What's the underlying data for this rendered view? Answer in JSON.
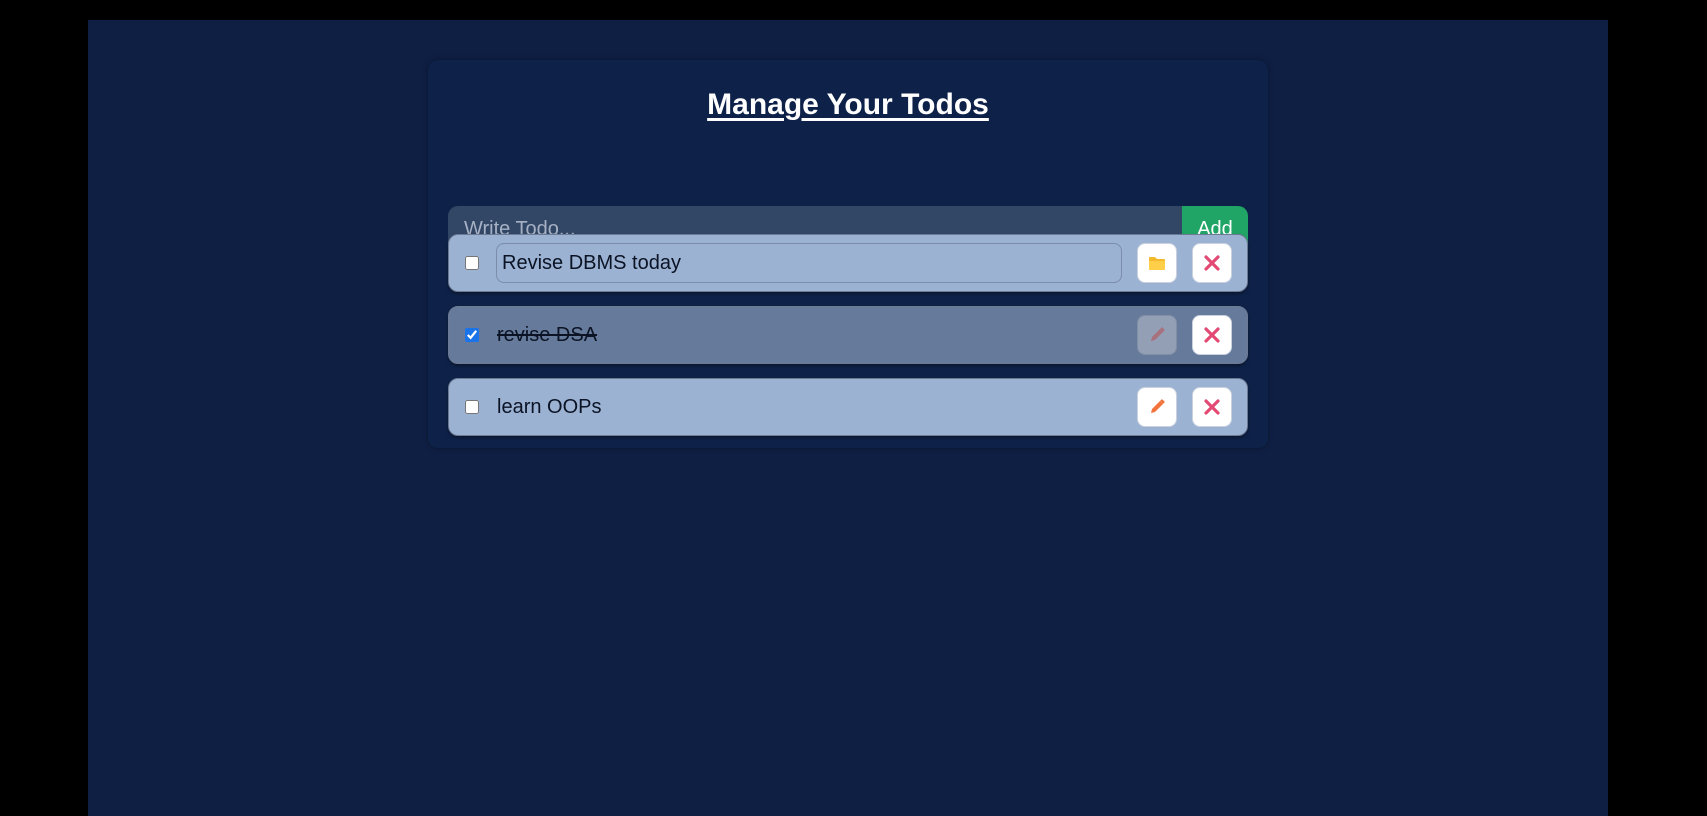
{
  "header": {
    "title": "Manage Your Todos"
  },
  "form": {
    "placeholder": "Write Todo...",
    "add_label": "Add"
  },
  "todos": [
    {
      "text": "Revise DBMS today",
      "completed": false,
      "editing": true,
      "action_icon": "folder-icon"
    },
    {
      "text": "revise DSA",
      "completed": true,
      "editing": false,
      "action_icon": "pencil-icon"
    },
    {
      "text": "learn OOPs",
      "completed": false,
      "editing": false,
      "action_icon": "pencil-icon"
    }
  ],
  "colors": {
    "page_bg": "#0f1f44",
    "card_bg": "#0e2249",
    "item_bg": "#9bb2d3",
    "item_done_bg": "#667a9b",
    "accent_add": "#21a567",
    "delete_icon": "#e24a74",
    "edit_icon": "#f2743c",
    "save_icon": "#f5b92e"
  }
}
